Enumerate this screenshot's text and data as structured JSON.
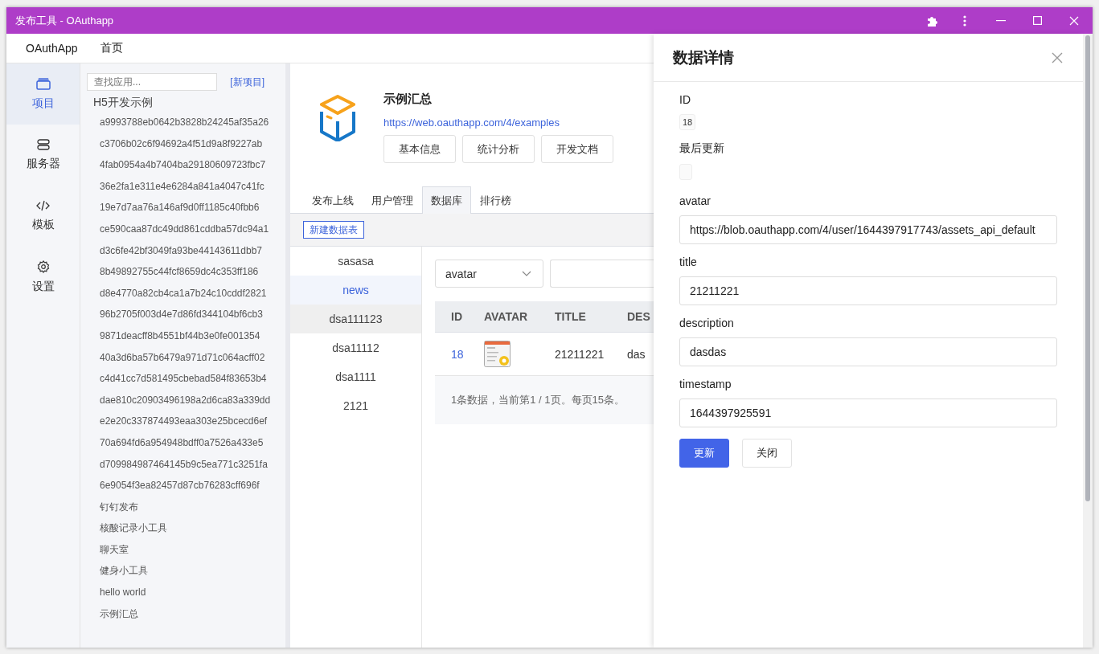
{
  "window": {
    "title": "发布工具 - OAuthapp"
  },
  "menu": [
    {
      "label": "OAuthApp"
    },
    {
      "label": "首页"
    }
  ],
  "nav": [
    {
      "label": "项目",
      "kind": "box",
      "selected": true
    },
    {
      "label": "服务器",
      "kind": "server",
      "selected": false
    },
    {
      "label": "模板",
      "kind": "code",
      "selected": false
    },
    {
      "label": "设置",
      "kind": "gear",
      "selected": false
    }
  ],
  "apps": {
    "search": {
      "placeholder": "查找应用..."
    },
    "new_link": "[新项目]",
    "tree": [
      {
        "name": "H5开发示例",
        "children": [
          {
            "name": "a9993788eb0642b3828b24245af35a26"
          },
          {
            "name": "c3706b02c6f94692a4f51d9a8f9227ab"
          },
          {
            "name": "4fab0954a4b7404ba29180609723fbc7"
          },
          {
            "name": "36e2fa1e311e4e6284a841a4047c41fc"
          },
          {
            "name": "19e7d7aa76a146af9d0ff1185c40fbb6"
          },
          {
            "name": "ce590caa87dc49dd861cddba57dc94a1"
          },
          {
            "name": "d3c6fe42bf3049fa93be44143611dbb7"
          },
          {
            "name": "8b49892755c44fcf8659dc4c353ff186"
          },
          {
            "name": "d8e4770a82cb4ca1a7b24c10cddf2821"
          },
          {
            "name": "96b2705f003d4e7d86fd344104bf6cb3"
          },
          {
            "name": "9871deacff8b4551bf44b3e0fe001354"
          },
          {
            "name": "40a3d6ba57b6479a971d71c064acff02"
          },
          {
            "name": "c4d41cc7d581495cbebad584f83653b4"
          },
          {
            "name": "dae810c20903496198a2d6ca83a339dd"
          },
          {
            "name": "e2e20c337874493eaa303e25bcecd6ef"
          },
          {
            "name": "70a694fd6a954948bdff0a7526a433e5"
          },
          {
            "name": "d709984987464145b9c5ea771c3251fa"
          },
          {
            "name": "6e9054f3ea82457d87cb76283cff696f"
          },
          {
            "name": "钉钉发布"
          },
          {
            "name": "核酸记录小工具"
          },
          {
            "name": "聊天室"
          },
          {
            "name": "健身小工具"
          },
          {
            "name": "hello world"
          },
          {
            "name": "示例汇总"
          }
        ]
      }
    ]
  },
  "project": {
    "title": "示例汇总",
    "url": "https://web.oauthapp.com/4/examples",
    "buttons": [
      "基本信息",
      "统计分析",
      "开发文档"
    ],
    "tabs": [
      {
        "label": "发布上线",
        "selected": false
      },
      {
        "label": "用户管理",
        "selected": false
      },
      {
        "label": "数据库",
        "selected": true
      },
      {
        "label": "排行榜",
        "selected": false
      }
    ],
    "new_table_button": "新建数据表"
  },
  "tables": [
    {
      "name": "sasasa",
      "selected": false,
      "hovered": false
    },
    {
      "name": "news",
      "selected": true,
      "hovered": false
    },
    {
      "name": "dsa111123",
      "selected": false,
      "hovered": true
    },
    {
      "name": "dsa11112",
      "selected": false,
      "hovered": false
    },
    {
      "name": "dsa1111",
      "selected": false,
      "hovered": false
    },
    {
      "name": "2121",
      "selected": false,
      "hovered": false
    }
  ],
  "filter": {
    "field": "avatar"
  },
  "grid": {
    "columns": [
      "ID",
      "AVATAR",
      "TITLE",
      "DES"
    ],
    "rows": [
      {
        "id": "18",
        "title": "21211221",
        "description": "das"
      }
    ],
    "pagination": "1条数据，当前第1 / 1页。每页15条。"
  },
  "drawer": {
    "title": "数据详情",
    "fields": [
      {
        "label": "ID",
        "kind": "tag",
        "value": "18"
      },
      {
        "label": "最后更新",
        "kind": "tag"
      },
      {
        "label": "avatar",
        "kind": "input",
        "value": "https://blob.oauthapp.com/4/user/1644397917743/assets_api_default"
      },
      {
        "label": "title",
        "kind": "input",
        "value": "21211221"
      },
      {
        "label": "description",
        "kind": "input",
        "value": "dasdas"
      },
      {
        "label": "timestamp",
        "kind": "input",
        "value": "1644397925591"
      }
    ],
    "buttons": [
      {
        "label": "更新",
        "kind": "primary"
      },
      {
        "label": "关闭",
        "kind": "default"
      }
    ]
  }
}
